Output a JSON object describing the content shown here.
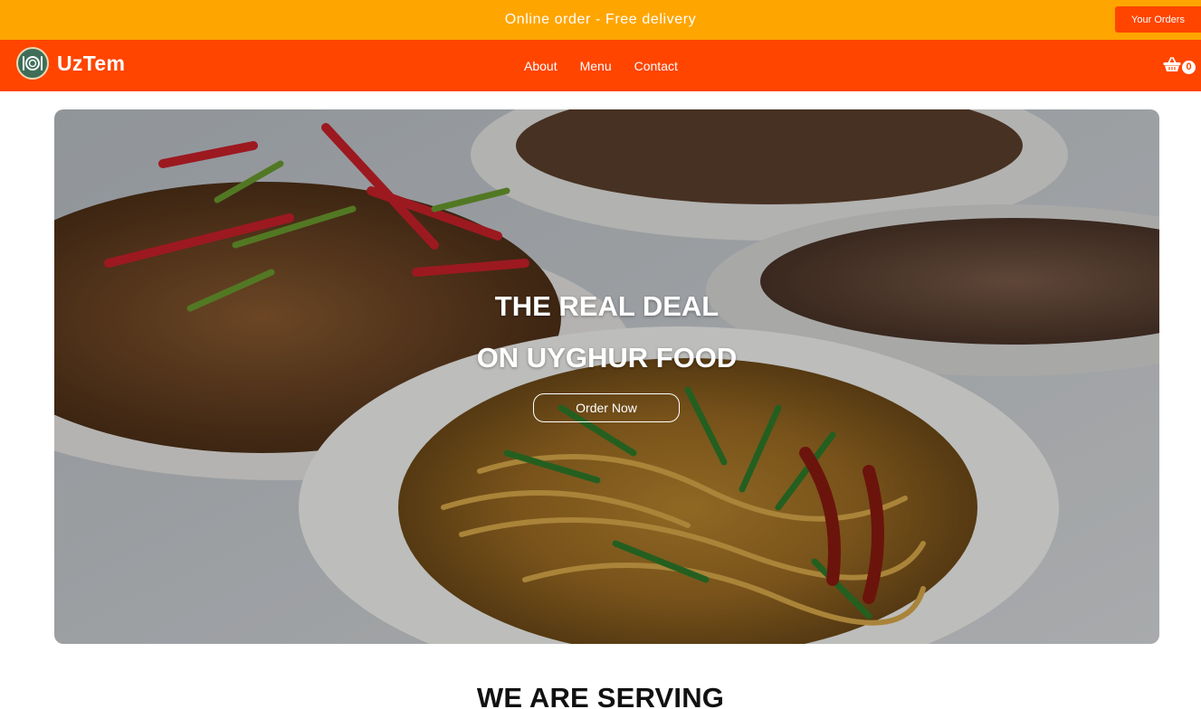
{
  "promo": {
    "text": "Online order - Free delivery",
    "orders_button": "Your Orders"
  },
  "nav": {
    "brand": "UzTem",
    "links": [
      "About",
      "Menu",
      "Contact"
    ],
    "cart_count": "0",
    "cart_icon": "basket-icon"
  },
  "hero": {
    "title_line1": "THE REAL DEAL",
    "title_line2": "ON UYGHUR FOOD",
    "cta": "Order Now"
  },
  "sections": {
    "serving_title": "WE ARE SERVING"
  },
  "colors": {
    "promo_bg": "#ffa500",
    "nav_bg": "#ff4500",
    "accent": "#ff4500"
  }
}
